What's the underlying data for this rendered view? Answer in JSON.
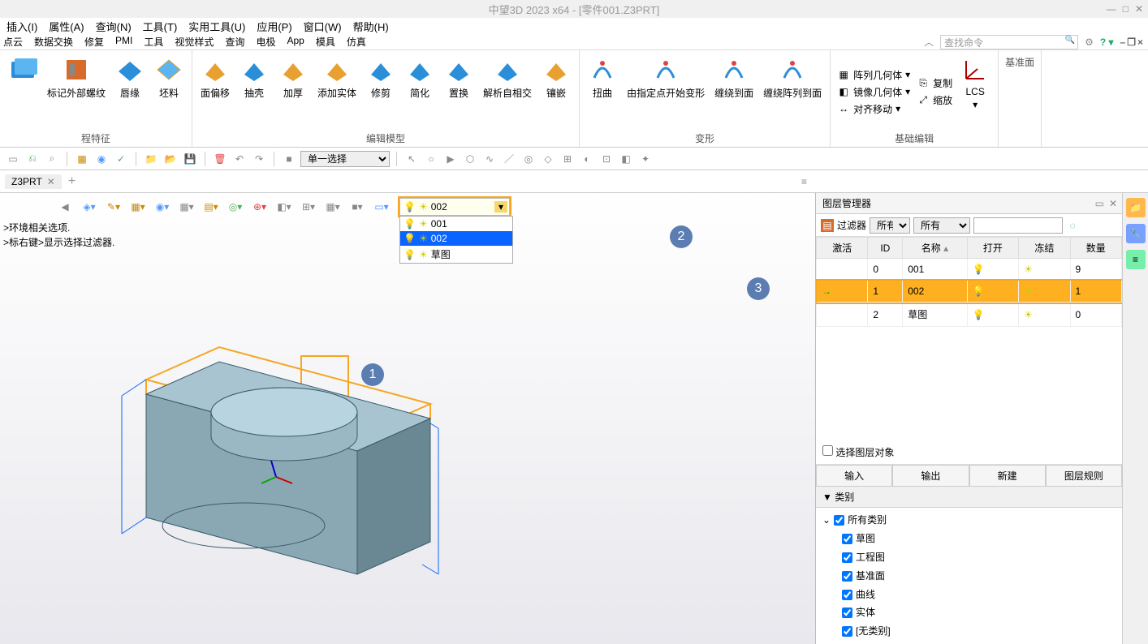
{
  "title": "中望3D 2023 x64 - [零件001.Z3PRT]",
  "menu": [
    "插入(I)",
    "属性(A)",
    "查询(N)",
    "工具(T)",
    "实用工具(U)",
    "应用(P)",
    "窗口(W)",
    "帮助(H)"
  ],
  "tabs": [
    "点云",
    "数据交换",
    "修复",
    "PMI",
    "工具",
    "视觉样式",
    "查询",
    "电极",
    "App",
    "模具",
    "仿真"
  ],
  "search_placeholder": "查找命令",
  "ribbon": {
    "group1": {
      "label": "程特征",
      "buttons": [
        "",
        "标记外部螺纹",
        "唇缘",
        "坯料"
      ]
    },
    "group2": {
      "label": "编辑模型",
      "buttons": [
        "面偏移",
        "抽壳",
        "加厚",
        "添加实体",
        "修剪",
        "简化",
        "置换",
        "解析自相交",
        "镶嵌"
      ]
    },
    "group3": {
      "label": "变形",
      "buttons": [
        "扭曲",
        "由指定点开始变形",
        "缠绕到面",
        "缠绕阵列到面"
      ]
    },
    "group4": {
      "label": "基础编辑",
      "items": [
        "阵列几何体",
        "镜像几何体",
        "对齐移动",
        "复制",
        "缩放"
      ],
      "lcs": "LCS"
    },
    "group5": {
      "label": "基准面"
    }
  },
  "selectMode": "单一选择",
  "docTab": "Z3PRT",
  "statusLines": [
    ">环境相关选项.",
    ">标右键>显示选择过滤器."
  ],
  "layerCombo": {
    "current": "002",
    "items": [
      "001",
      "002",
      "草图"
    ]
  },
  "panel": {
    "title": "图层管理器",
    "filterLabel": "过滤器",
    "filterAll": "所有",
    "columns": [
      "激活",
      "ID",
      "名称",
      "打开",
      "冻结",
      "数量"
    ],
    "rows": [
      {
        "active": "",
        "id": "0",
        "name": "001",
        "open": true,
        "freeze": false,
        "count": "9"
      },
      {
        "active": "→",
        "id": "1",
        "name": "002",
        "open": true,
        "freeze": false,
        "count": "1",
        "selected": true
      },
      {
        "active": "",
        "id": "2",
        "name": "草图",
        "open": true,
        "freeze": false,
        "count": "0"
      }
    ],
    "pickLabel": "选择图层对象",
    "buttons": [
      "输入",
      "输出",
      "新建",
      "图层规则"
    ],
    "catHeader": "类别",
    "categories": [
      "所有类别",
      "草图",
      "工程图",
      "基准面",
      "曲线",
      "实体",
      "[无类别]"
    ]
  }
}
